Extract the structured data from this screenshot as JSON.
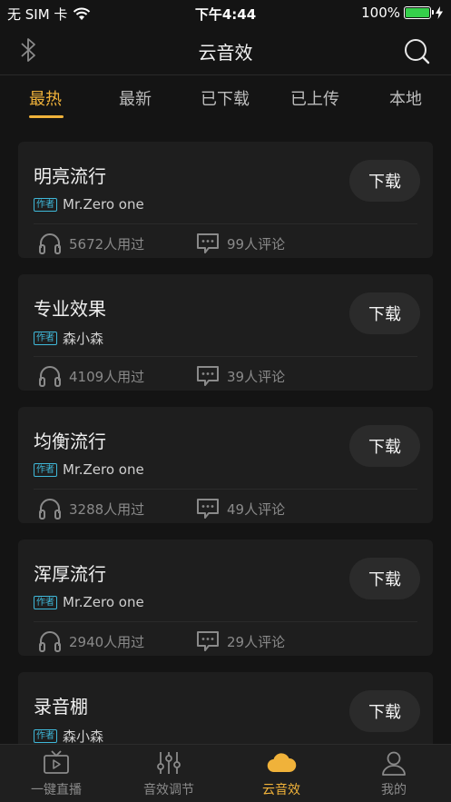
{
  "status_bar": {
    "carrier": "无 SIM 卡",
    "time": "下午4:44",
    "battery": "100%"
  },
  "nav": {
    "title": "云音效"
  },
  "tabs": [
    {
      "label": "最热",
      "active": true
    },
    {
      "label": "最新",
      "active": false
    },
    {
      "label": "已下载",
      "active": false
    },
    {
      "label": "已上传",
      "active": false
    },
    {
      "label": "本地",
      "active": false
    }
  ],
  "author_tag": "作者",
  "download_label": "下载",
  "effects": [
    {
      "title": "明亮流行",
      "author": "Mr.Zero one",
      "used": "5672人用过",
      "comments": "99人评论"
    },
    {
      "title": "专业效果",
      "author": "森小森",
      "used": "4109人用过",
      "comments": "39人评论"
    },
    {
      "title": "均衡流行",
      "author": "Mr.Zero one",
      "used": "3288人用过",
      "comments": "49人评论"
    },
    {
      "title": "浑厚流行",
      "author": "Mr.Zero one",
      "used": "2940人用过",
      "comments": "29人评论"
    },
    {
      "title": "录音棚",
      "author": "森小森",
      "used": "",
      "comments": ""
    }
  ],
  "tabbar": [
    {
      "label": "一键直播",
      "icon": "tv-play-icon",
      "active": false
    },
    {
      "label": "音效调节",
      "icon": "equalizer-icon",
      "active": false
    },
    {
      "label": "云音效",
      "icon": "cloud-icon",
      "active": true
    },
    {
      "label": "我的",
      "icon": "user-icon",
      "active": false
    }
  ],
  "colors": {
    "accent": "#f0b23a",
    "author_tag": "#3fb8d9",
    "background": "#141414",
    "card": "#1e1e1e"
  }
}
